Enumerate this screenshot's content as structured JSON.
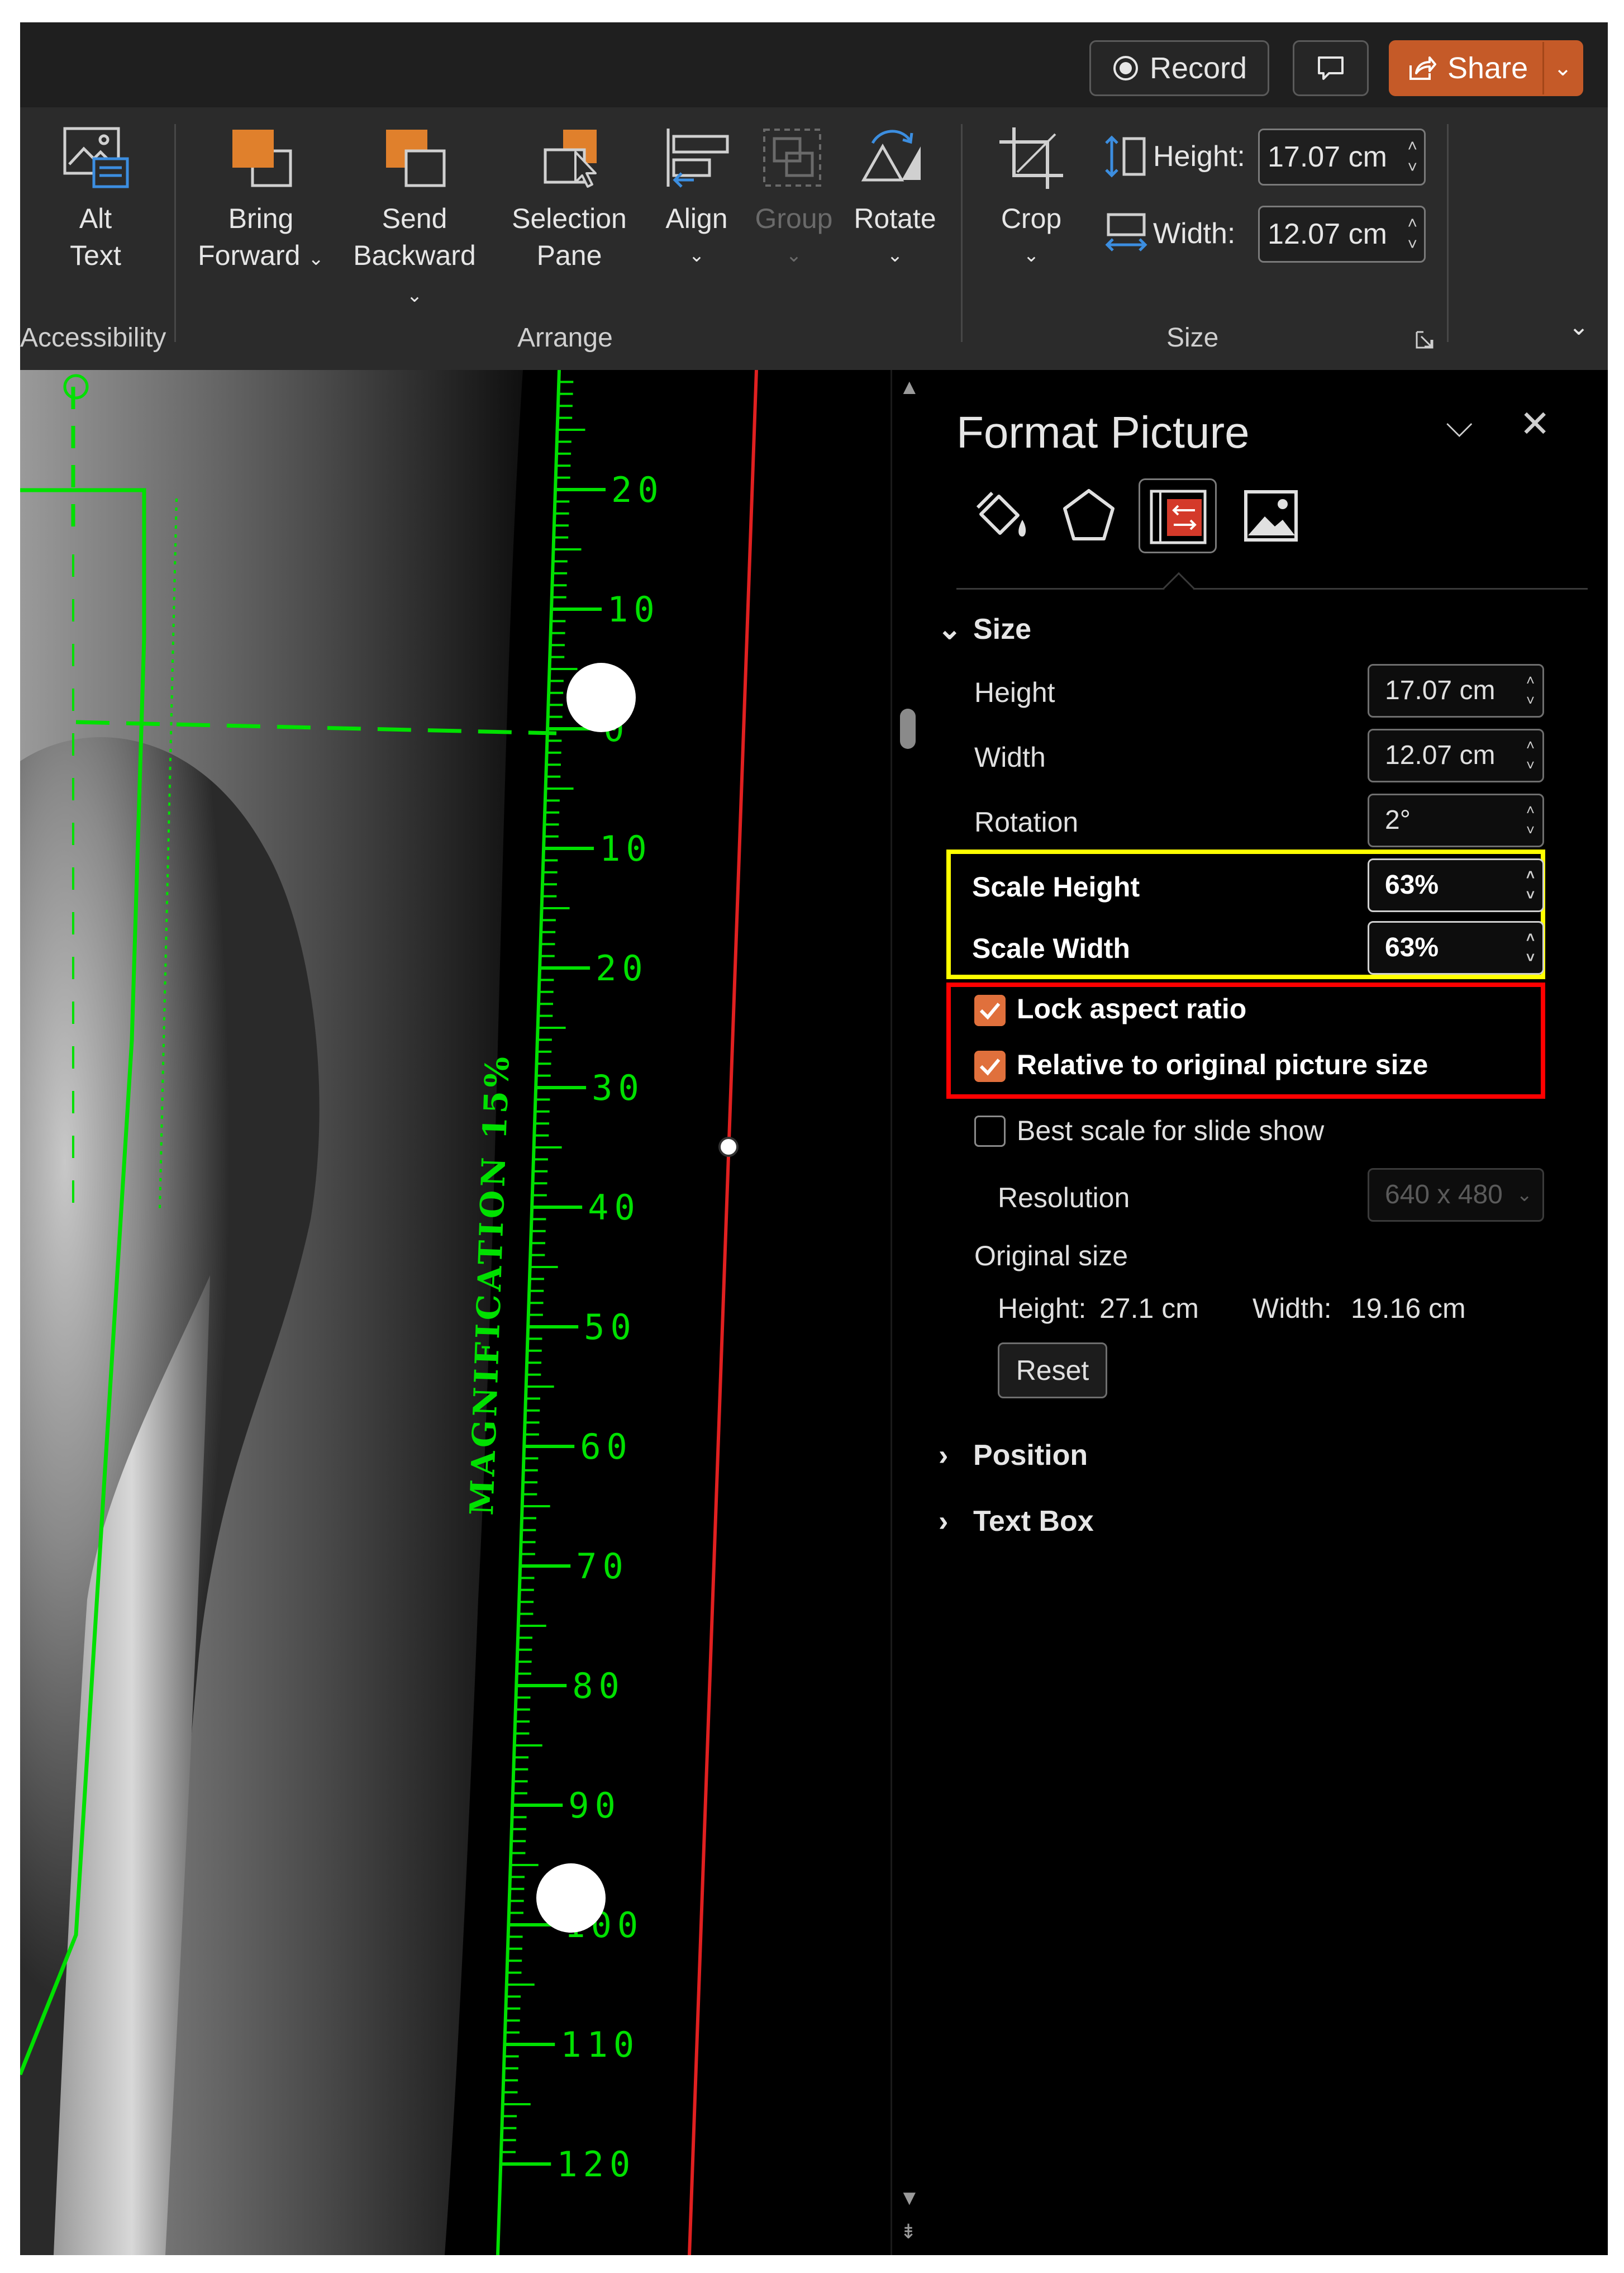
{
  "topbar": {
    "record_label": "Record",
    "share_label": "Share"
  },
  "ribbon": {
    "alt_text": [
      "Alt",
      "Text"
    ],
    "accessibility_group": "Accessibility",
    "bring_forward": [
      "Bring",
      "Forward"
    ],
    "send_backward": [
      "Send",
      "Backward"
    ],
    "selection_pane": [
      "Selection",
      "Pane"
    ],
    "align": "Align",
    "group": "Group",
    "rotate": "Rotate",
    "arrange_group": "Arrange",
    "crop": "Crop",
    "height_label": "Height:",
    "height_value": "17.07 cm",
    "width_label": "Width:",
    "width_value": "12.07 cm",
    "size_group": "Size"
  },
  "xray": {
    "ruler_label": "MAGNIFICATION 15%",
    "ticks": [
      "20",
      "10",
      "0",
      "10",
      "20",
      "30",
      "40",
      "50",
      "60",
      "70",
      "80",
      "90",
      "100",
      "110",
      "120"
    ]
  },
  "pane": {
    "title": "Format Picture",
    "size_section": "Size",
    "height_label": "Height",
    "height_value": "17.07 cm",
    "width_label": "Width",
    "width_value": "12.07 cm",
    "rotation_label": "Rotation",
    "rotation_value": "2°",
    "scale_height_label": "Scale Height",
    "scale_height_value": "63%",
    "scale_width_label": "Scale Width",
    "scale_width_value": "63%",
    "lock_aspect_label": "Lock aspect ratio",
    "lock_aspect_checked": true,
    "relative_label": "Relative to original picture size",
    "relative_checked": true,
    "best_scale_label": "Best scale for slide show",
    "best_scale_checked": false,
    "resolution_label": "Resolution",
    "resolution_value": "640 x 480",
    "original_size_label": "Original size",
    "orig_height_label": "Height:",
    "orig_height_value": "27.1 cm",
    "orig_width_label": "Width:",
    "orig_width_value": "19.16 cm",
    "reset_label": "Reset",
    "position_section": "Position",
    "textbox_section": "Text Box"
  },
  "colors": {
    "accent": "#c55a28",
    "checkbox": "#e0703c",
    "highlight_yellow": "#ffff00",
    "highlight_red": "#ff0000",
    "overlay_green": "#00e000",
    "reference_line": "#e02020"
  }
}
